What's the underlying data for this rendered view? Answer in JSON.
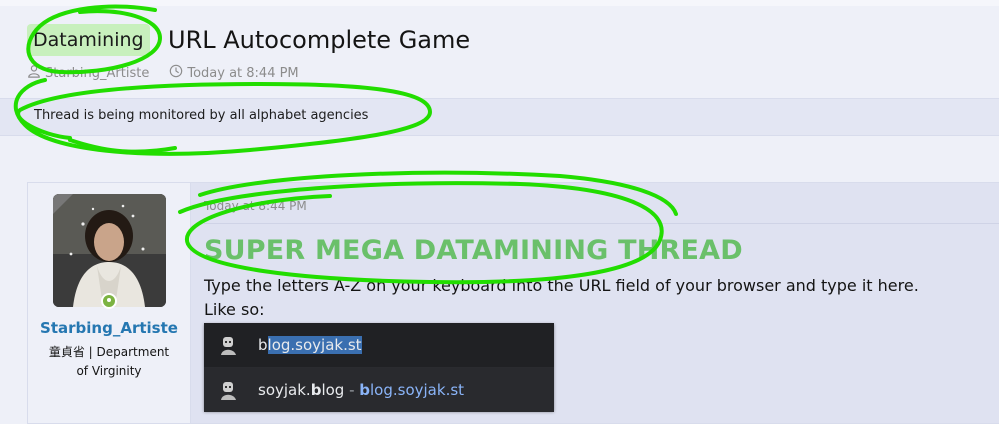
{
  "thread": {
    "prefix": "Datamining",
    "title": "URL Autocomplete Game",
    "author": "Starbing_Artiste",
    "time": "Today at 8:44 PM"
  },
  "notice": {
    "text": "Thread is being monitored by all alphabet agencies"
  },
  "post": {
    "date": "Today at 8:44 PM",
    "heading": "SUPER MEGA DATAMINING THREAD",
    "line1": "Type the letters A-Z on your keyboard into the URL field of your browser and type it here.",
    "line2": "Like so:",
    "user": {
      "name": "Starbing_Artiste",
      "title_line1": "童貞省 | Department",
      "title_line2": "of Virginity",
      "status": "online"
    }
  },
  "autocomplete": {
    "row1": {
      "typed": "b",
      "completion": "log.soyjak.st"
    },
    "row2": {
      "pre": "soyjak.",
      "bold": "b",
      "post": "log",
      "dash": " - ",
      "url_bold": "b",
      "url_rest": "log.soyjak.st"
    }
  },
  "colors": {
    "accent_link": "#2577b1",
    "prefix_bg": "#c8f0bd",
    "heading_green": "#6ac06a",
    "scribble_green": "#22dd00",
    "online": "#7cb342"
  }
}
